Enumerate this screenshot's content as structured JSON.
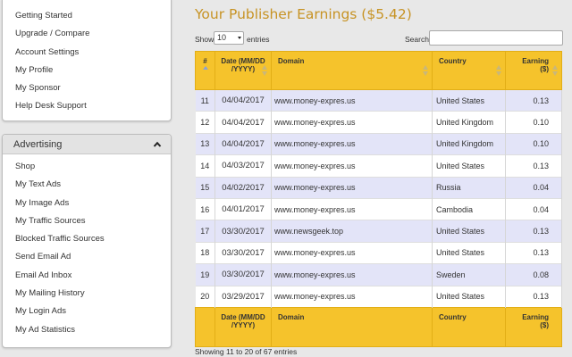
{
  "sidebar": {
    "account_items": [
      {
        "label": "Getting Started"
      },
      {
        "label": "Upgrade / Compare"
      },
      {
        "label": "Account Settings"
      },
      {
        "label": "My Profile"
      },
      {
        "label": "My Sponsor"
      },
      {
        "label": "Help Desk Support"
      }
    ],
    "advertising": {
      "title": "Advertising",
      "items": [
        {
          "label": "Shop"
        },
        {
          "label": "My Text Ads"
        },
        {
          "label": "My Image Ads"
        },
        {
          "label": "My Traffic Sources"
        },
        {
          "label": "Blocked Traffic Sources"
        },
        {
          "label": "Send Email Ad"
        },
        {
          "label": "Email Ad Inbox"
        },
        {
          "label": "My Mailing History"
        },
        {
          "label": "My Login Ads"
        },
        {
          "label": "My Ad Statistics"
        }
      ]
    }
  },
  "main": {
    "title": "Your Publisher Earnings ($5.42)",
    "controls": {
      "show_label": "Show",
      "page_length": "10",
      "entries_label": "entries",
      "search_label": "Search:",
      "search_value": ""
    },
    "table": {
      "headers": {
        "num": "#",
        "date": "Date (MM/DD /YYYY)",
        "domain": "Domain",
        "country": "Country",
        "earning": "Earning ($)"
      },
      "rows": [
        {
          "num": "11",
          "date": "04/04/2017",
          "domain": "www.money-expres.us",
          "country": "United States",
          "earning": "0.13"
        },
        {
          "num": "12",
          "date": "04/04/2017",
          "domain": "www.money-expres.us",
          "country": "United Kingdom",
          "earning": "0.10"
        },
        {
          "num": "13",
          "date": "04/04/2017",
          "domain": "www.money-expres.us",
          "country": "United Kingdom",
          "earning": "0.10"
        },
        {
          "num": "14",
          "date": "04/03/2017",
          "domain": "www.money-expres.us",
          "country": "United States",
          "earning": "0.13"
        },
        {
          "num": "15",
          "date": "04/02/2017",
          "domain": "www.money-expres.us",
          "country": "Russia",
          "earning": "0.04"
        },
        {
          "num": "16",
          "date": "04/01/2017",
          "domain": "www.money-expres.us",
          "country": "Cambodia",
          "earning": "0.04"
        },
        {
          "num": "17",
          "date": "03/30/2017",
          "domain": "www.newsgeek.top",
          "country": "United States",
          "earning": "0.13"
        },
        {
          "num": "18",
          "date": "03/30/2017",
          "domain": "www.money-expres.us",
          "country": "United States",
          "earning": "0.13"
        },
        {
          "num": "19",
          "date": "03/30/2017",
          "domain": "www.money-expres.us",
          "country": "Sweden",
          "earning": "0.08"
        },
        {
          "num": "20",
          "date": "03/29/2017",
          "domain": "www.money-expres.us",
          "country": "United States",
          "earning": "0.13"
        }
      ],
      "info": "Showing 11 to 20 of 67 entries"
    }
  },
  "colors": {
    "title": "#c79324",
    "header_bg": "#f5c32c",
    "row_odd": "#e3e4f8",
    "row_even": "#ffffff",
    "page_bg": "#e8e8e8",
    "sort_icon": "#c9b77a",
    "sort_active": "#8aa2d8"
  }
}
